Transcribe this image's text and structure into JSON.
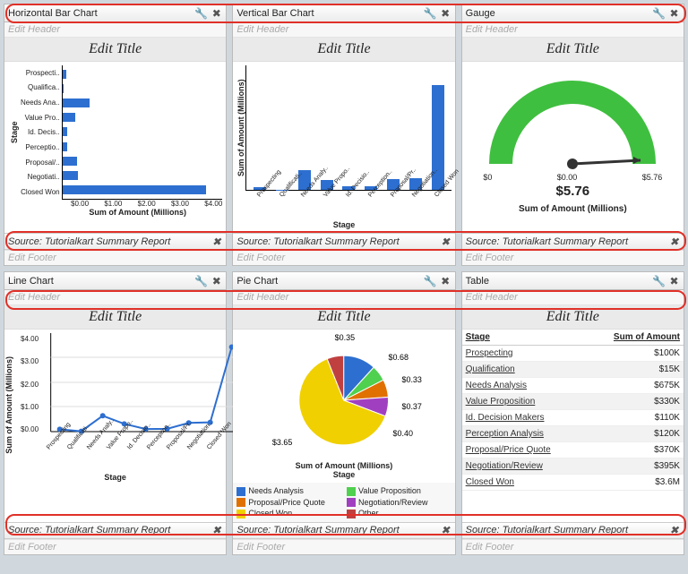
{
  "labels": {
    "edit_header": "Edit Header",
    "edit_title": "Edit Title",
    "edit_footer": "Edit Footer",
    "source": "Source: Tutorialkart Summary Report",
    "sum_amount_m": "Sum of Amount (Millions)",
    "stage": "Stage"
  },
  "widgets": {
    "hbar": {
      "title": "Horizontal Bar Chart"
    },
    "vbar": {
      "title": "Vertical Bar Chart"
    },
    "gauge": {
      "title": "Gauge",
      "value": "$5.76",
      "min": "$0",
      "mid": "$0.00",
      "max": "$5.76"
    },
    "line": {
      "title": "Line Chart"
    },
    "pie": {
      "title": "Pie Chart"
    },
    "table": {
      "title": "Table",
      "col1": "Stage",
      "col2": "Sum of Amount"
    }
  },
  "table_rows": [
    {
      "stage": "Prospecting",
      "amt": "$100K"
    },
    {
      "stage": "Qualification",
      "amt": "$15K"
    },
    {
      "stage": "Needs Analysis",
      "amt": "$675K"
    },
    {
      "stage": "Value Proposition",
      "amt": "$330K"
    },
    {
      "stage": "Id. Decision Makers",
      "amt": "$110K"
    },
    {
      "stage": "Perception Analysis",
      "amt": "$120K"
    },
    {
      "stage": "Proposal/Price Quote",
      "amt": "$370K"
    },
    {
      "stage": "Negotiation/Review",
      "amt": "$395K"
    },
    {
      "stage": "Closed Won",
      "amt": "$3.6M"
    }
  ],
  "stages_short": [
    "Prospecti..",
    "Qualifica..",
    "Needs Ana..",
    "Value Pro..",
    "Id. Decis..",
    "Perceptio..",
    "Proposal/..",
    "Negotiati..",
    "Closed Won"
  ],
  "stages_rot": [
    "Prospecting",
    "Qualificati..",
    "Needs Analy..",
    "Value Propo..",
    "Id. Decisio..",
    "Perception..",
    "Proposal/Pr..",
    "Negotiation..",
    "Closed Won"
  ],
  "hbar_xticks": [
    "$0.00",
    "$1.00",
    "$2.00",
    "$3.00",
    "$4.00"
  ],
  "line_yticks": [
    "$4.00",
    "$3.00",
    "$2.00",
    "$1.00",
    "$0.00"
  ],
  "pie_slice_labels": [
    "$0.35",
    "$0.68",
    "$0.33",
    "$0.37",
    "$0.40",
    "$3.65"
  ],
  "pie_legend": [
    {
      "c": "#2d6fd0",
      "t": "Needs Analysis"
    },
    {
      "c": "#4fd04f",
      "t": "Value Proposition"
    },
    {
      "c": "#e07000",
      "t": "Proposal/Price Quote"
    },
    {
      "c": "#a040c0",
      "t": "Negotiation/Review"
    },
    {
      "c": "#f0d000",
      "t": "Closed Won"
    },
    {
      "c": "#c04040",
      "t": "Other"
    }
  ],
  "chart_data": [
    {
      "type": "bar",
      "orientation": "horizontal",
      "title": "Edit Title",
      "ylabel": "Stage",
      "xlabel": "Sum of Amount (Millions)",
      "xlim": [
        0,
        4
      ],
      "categories": [
        "Prospecting",
        "Qualification",
        "Needs Analysis",
        "Value Proposition",
        "Id. Decision Makers",
        "Perception Analysis",
        "Proposal/Price Quote",
        "Negotiation/Review",
        "Closed Won"
      ],
      "values": [
        0.1,
        0.015,
        0.675,
        0.33,
        0.11,
        0.12,
        0.37,
        0.395,
        3.6
      ]
    },
    {
      "type": "bar",
      "orientation": "vertical",
      "title": "Edit Title",
      "xlabel": "Stage",
      "ylabel": "Sum of Amount (Millions)",
      "ylim": [
        0,
        4
      ],
      "categories": [
        "Prospecting",
        "Qualification",
        "Needs Analysis",
        "Value Proposition",
        "Id. Decision Makers",
        "Perception Analysis",
        "Proposal/Price Quote",
        "Negotiation/Review",
        "Closed Won"
      ],
      "values": [
        0.1,
        0.015,
        0.675,
        0.33,
        0.11,
        0.12,
        0.37,
        0.395,
        3.6
      ]
    },
    {
      "type": "gauge",
      "title": "Edit Title",
      "xlabel": "Sum of Amount (Millions)",
      "min": 0,
      "max": 5.76,
      "value": 5.76
    },
    {
      "type": "line",
      "title": "Edit Title",
      "xlabel": "Stage",
      "ylabel": "Sum of Amount (Millions)",
      "ylim": [
        0,
        4
      ],
      "categories": [
        "Prospecting",
        "Qualification",
        "Needs Analysis",
        "Value Proposition",
        "Id. Decision Makers",
        "Perception Analysis",
        "Proposal/Price Quote",
        "Negotiation/Review",
        "Closed Won"
      ],
      "values": [
        0.1,
        0.015,
        0.675,
        0.33,
        0.11,
        0.12,
        0.37,
        0.395,
        3.6
      ]
    },
    {
      "type": "pie",
      "title": "Edit Title",
      "xlabel": "Stage",
      "caption": "Sum of Amount (Millions)",
      "series": [
        {
          "name": "Needs Analysis",
          "value": 0.68,
          "color": "#2d6fd0"
        },
        {
          "name": "Value Proposition",
          "value": 0.33,
          "color": "#4fd04f"
        },
        {
          "name": "Proposal/Price Quote",
          "value": 0.37,
          "color": "#e07000"
        },
        {
          "name": "Negotiation/Review",
          "value": 0.4,
          "color": "#a040c0"
        },
        {
          "name": "Closed Won",
          "value": 3.65,
          "color": "#f0d000"
        },
        {
          "name": "Other",
          "value": 0.35,
          "color": "#c04040"
        }
      ]
    },
    {
      "type": "table",
      "title": "Edit Title",
      "columns": [
        "Stage",
        "Sum of Amount"
      ],
      "rows": [
        [
          "Prospecting",
          "$100K"
        ],
        [
          "Qualification",
          "$15K"
        ],
        [
          "Needs Analysis",
          "$675K"
        ],
        [
          "Value Proposition",
          "$330K"
        ],
        [
          "Id. Decision Makers",
          "$110K"
        ],
        [
          "Perception Analysis",
          "$120K"
        ],
        [
          "Proposal/Price Quote",
          "$370K"
        ],
        [
          "Negotiation/Review",
          "$395K"
        ],
        [
          "Closed Won",
          "$3.6M"
        ]
      ]
    }
  ]
}
